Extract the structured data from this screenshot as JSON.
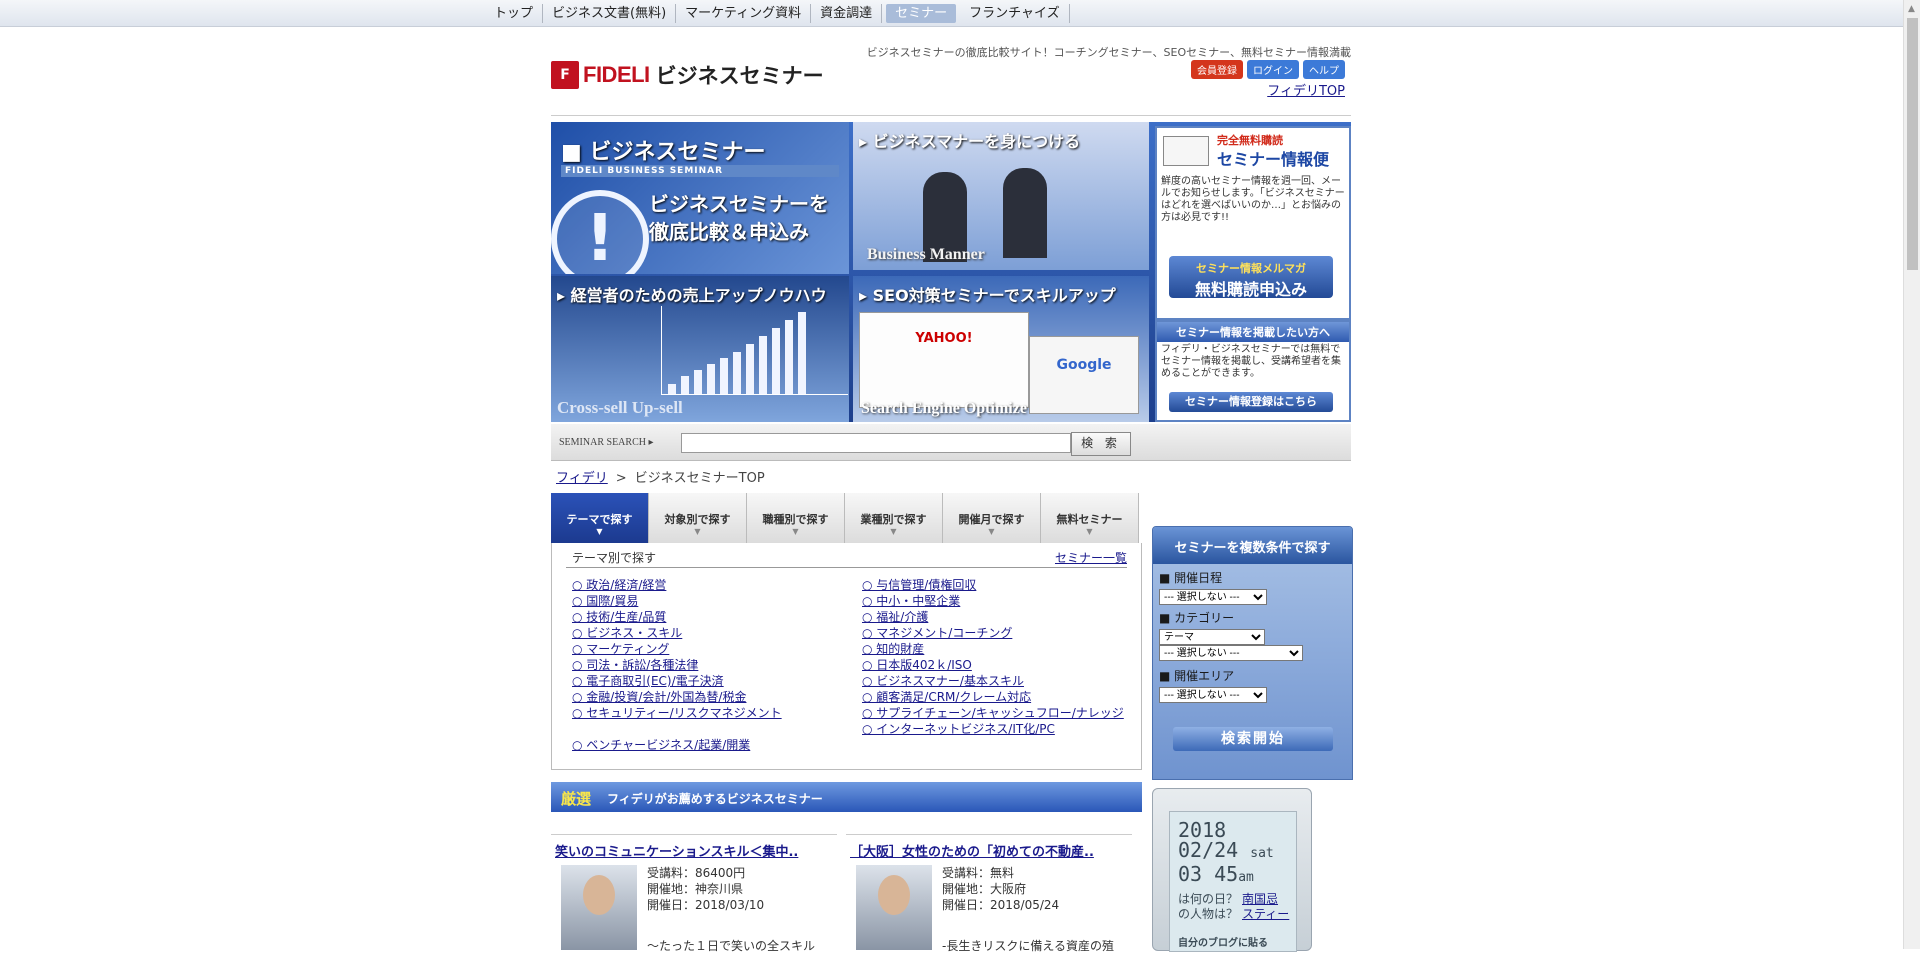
{
  "topnav": {
    "items": [
      "トップ",
      "ビジネス文書(無料)",
      "マーケティング資料",
      "資金調達",
      "セミナー",
      "フランチャイズ"
    ],
    "active_index": 4
  },
  "header": {
    "logo_mark": "F",
    "brand": "FIDELI",
    "site_title": "ビジネスセミナー",
    "tagline": "ビジネスセミナーの徹底比較サイト！コーチングセミナー、SEOセミナー、無料セミナー情報満載",
    "register_label": "会員登録",
    "login_label": "ログイン",
    "help_label": "ヘルプ",
    "top_link": "フィデリTOP"
  },
  "banner": {
    "main": {
      "heading": "■ ビジネスセミナー",
      "sub": "FIDELI BUSINESS SEMINAR",
      "catch1": "ビジネスセミナーを",
      "catch2": "徹底比較＆申込み",
      "icon": "exclamation-icon"
    },
    "manner": {
      "heading": "ビジネスマナーを身につける",
      "caption": "Business Manner"
    },
    "sales": {
      "heading": "経営者のための売上アップノウハウ",
      "caption": "Cross-sell  Up-sell"
    },
    "seo": {
      "heading": "SEO対策セミナーでスキルアップ",
      "caption": "Search Engine Optimize",
      "shot1": "YAHOO!",
      "shot2": "Google"
    },
    "mail": {
      "free": "完全無料購読",
      "name": "セミナー情報便",
      "desc": "鮮度の高いセミナー情報を週一回、メールでお知らせします。「ビジネスセミナーはどれを選べばいいのか…」とお悩みの方は必見です!!",
      "cta_line1": "セミナー情報メルマガ",
      "cta_line2": "無料購読申込み"
    },
    "post": {
      "heading": "セミナー情報を掲載したい方へ",
      "desc": "フィデリ・ビジネスセミナーでは無料でセミナー情報を掲載し、受講希望者を集めることができます。",
      "cta": "セミナー情報登録はこちら"
    }
  },
  "search": {
    "label": "SEMINAR SEARCH ▸",
    "value": "",
    "placeholder": "",
    "button": "検 索"
  },
  "breadcrumb": {
    "home": "フィデリ",
    "sep": ">",
    "current": "ビジネスセミナーTOP"
  },
  "tabs": [
    "テーマで探す",
    "対象別で探す",
    "職種別で探す",
    "業種別で探す",
    "開催月で探す",
    "無料セミナー"
  ],
  "themes": {
    "subhead": "テーマ別で探す",
    "list_link": "セミナー一覧",
    "left": [
      "○ 政治/経済/経営",
      "○ 国際/貿易",
      "○ 技術/生産/品質",
      "○ ビジネス・スキル",
      "○ マーケティング",
      "○ 司法・訴訟/各種法律",
      "○ 電子商取引(EC)/電子決済",
      "○ 金融/投資/会計/外国為替/税金",
      "○ セキュリティー/リスクマネジメント",
      "○ ベンチャービジネス/起業/開業"
    ],
    "right": [
      "○ 与信管理/債権回収",
      "○ 中小・中堅企業",
      "○ 福祉/介護",
      "○ マネジメント/コーチング",
      "○ 知的財産",
      "○ 日本版402ｋ/ISO",
      "○ ビジネスマナー/基本スキル",
      "○ 顧客満足/CRM/クレーム対応",
      "○ サプライチェーン/キャッシュフロー/ナレッジ",
      "○ インターネットビジネス/IT化/PC"
    ]
  },
  "recommend": {
    "pick": "厳選",
    "title": "フィデリがお薦めするビジネスセミナー",
    "cards": [
      {
        "title": "笑いのコミュニケーションスキル＜集中..",
        "fee": "受講料：86400円",
        "place": "開催地：神奈川県",
        "date": "開催日：2018/03/10",
        "excerpt": "～たった１日で笑いの全スキル"
      },
      {
        "title": "［大阪］女性のための「初めての不動産..",
        "fee": "受講料：無料",
        "place": "開催地：大阪府",
        "date": "開催日：2018/05/24",
        "excerpt": "-長生きリスクに備える資産の殖"
      }
    ]
  },
  "cond": {
    "heading": "セミナーを複数条件で探す",
    "date_label": "■ 開催日程",
    "date_value": "--- 選択しない ---",
    "category_label": "■ カテゴリー",
    "category_value": "テーマ",
    "category_sub_value": "--- 選択しない ---",
    "area_label": "■ 開催エリア",
    "area_value": "--- 選択しない ---",
    "submit": "検索開始"
  },
  "clock": {
    "year": "2018",
    "date": "02/24",
    "dow": "sat",
    "time": "03 45",
    "time_unit": "am",
    "q1": "は何の日？",
    "q2": "の人物は？",
    "a1": "南国忌",
    "a2": "スティー",
    "blog": "自分のブログに貼る"
  }
}
